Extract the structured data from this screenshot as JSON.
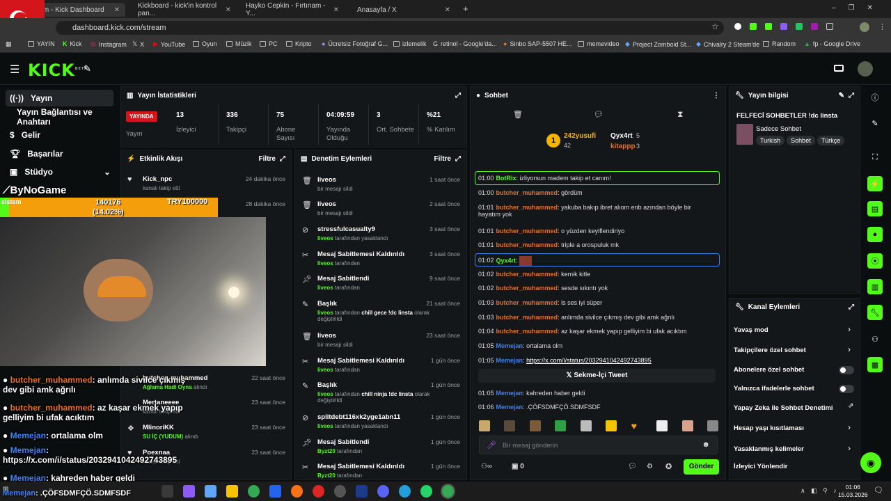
{
  "browser": {
    "tabs": [
      {
        "title": "Stream - Kick Dashboard",
        "active": true
      },
      {
        "title": "Kickboard - kick'in kontrol pan..."
      },
      {
        "title": "Hayko Cepkin - Fırtınam - Y..."
      },
      {
        "title": "Anasayfa / X"
      }
    ],
    "url": "dashboard.kick.com/stream",
    "bookmarks": [
      "YAYIN",
      "Kick",
      "Instagram",
      "X",
      "YouTube",
      "Oyun",
      "Müzik",
      "PC",
      "Kripto",
      "Ücretsiz Fotoğraf G...",
      "izlemelik",
      "retinol - Google'da...",
      "Sinbo SAP-5507 HE...",
      "memevideo",
      "Project Zomboid St...",
      "Chivalry 2 Steam'de",
      "Random",
      "fp - Google Drive"
    ]
  },
  "brand": {
    "logo": "KICK",
    "beta": "BETA",
    "accent": "#53fc18"
  },
  "sidebar": {
    "items": [
      {
        "label": "Yayın",
        "active": true
      },
      {
        "label": "Yayın Bağlantısı ve Anahtarı"
      },
      {
        "label": "Gelir"
      },
      {
        "label": "Başarılar"
      },
      {
        "label": "Stüdyo"
      }
    ]
  },
  "stats": {
    "title": "Yayın İstatistikleri",
    "status_badge": "YAYINDA",
    "status_label": "Yayın",
    "items": [
      {
        "value": "13",
        "label": "İzleyici"
      },
      {
        "value": "336",
        "label": "Takipçi"
      },
      {
        "value": "75",
        "label": "Abone Sayısı"
      },
      {
        "value": "04:09:59",
        "label": "Yayında Olduğu"
      },
      {
        "value": "3",
        "label": "Ort. Sohbete"
      },
      {
        "value": "%21",
        "label": "% Katılım"
      }
    ]
  },
  "activity": {
    "title": "Etkinlik Akışı",
    "filter": "Filtre",
    "items": [
      {
        "name": "Kick_npc",
        "desc": "kanalı takip etti",
        "time": "24 dakika önce"
      },
      {
        "name": "",
        "desc": "",
        "time": "28 dakika önce"
      },
      {
        "name": "butcher_muhammed",
        "desc": "Ağlama Hadi Oyna",
        "desc2": "alındı",
        "time": "22 saat önce"
      },
      {
        "name": "Mertaneeee",
        "desc": "kanalı takip etti",
        "time": "23 saat önce"
      },
      {
        "name": "MlinoriKK",
        "desc": "SU İÇ (YUDUM)",
        "desc2": "alındı",
        "time": "23 saat önce"
      },
      {
        "name": "Poexnaa",
        "desc": "kanalı takip etti",
        "time": "23 saat önce"
      }
    ]
  },
  "moderation": {
    "title": "Denetim Eylemleri",
    "filter": "Filtre",
    "items": [
      {
        "name": "liveos",
        "desc": "bir mesajı sildi",
        "time": "1 saat önce",
        "icon": "trash-icon"
      },
      {
        "name": "liveos",
        "desc": "bir mesajı sildi",
        "time": "2 saat önce",
        "icon": "trash-icon"
      },
      {
        "name": "stressfulcasualty9",
        "by": "liveos",
        "desc": "tarafından yasaklandı",
        "time": "3 saat önce",
        "icon": "ban-icon"
      },
      {
        "name": "Mesaj Sabitlemesi Kaldırıldı",
        "by": "liveos",
        "desc": "tarafından",
        "time": "3 saat önce",
        "icon": "unpin-icon"
      },
      {
        "name": "Mesaj Sabitlendi",
        "by": "liveos",
        "desc": "tarafından",
        "time": "9 saat önce",
        "icon": "pin-icon"
      },
      {
        "name": "Başlık",
        "by": "liveos",
        "desc": "tarafından",
        "extra": "chill gece !dc linsta",
        "desc2": "olarak değiştirildi",
        "time": "21 saat önce",
        "icon": "title-icon"
      },
      {
        "name": "liveos",
        "desc": "bir mesajı sildi",
        "time": "23 saat önce",
        "icon": "trash-icon"
      },
      {
        "name": "Mesaj Sabitlemesi Kaldırıldı",
        "by": "liveos",
        "desc": "tarafından",
        "time": "1 gün önce",
        "icon": "unpin-icon"
      },
      {
        "name": "Başlık",
        "by": "liveos",
        "desc": "tarafından",
        "extra": "chill ninja !dc linsta",
        "desc2": "olarak değiştirildi",
        "time": "1 gün önce",
        "icon": "title-icon"
      },
      {
        "name": "splitdebt116xk2yge1abn11",
        "by": "liveos",
        "desc": "tarafından yasaklandı",
        "time": "1 gün önce",
        "icon": "ban-icon"
      },
      {
        "name": "Mesaj Sabitlendi",
        "by": "Byzt20",
        "desc": "tarafından",
        "time": "1 gün önce",
        "icon": "pin-icon"
      },
      {
        "name": "Mesaj Sabitlemesi Kaldırıldı",
        "by": "Byzt20",
        "desc": "tarafından",
        "time": "1 gün önce",
        "icon": "unpin-icon"
      }
    ]
  },
  "chat": {
    "title": "Sohbet",
    "leaderboard": {
      "top": "242yusufi",
      "top_value": "42",
      "rank": "1",
      "second": "Qyx4rt",
      "second_value": "5",
      "third": "kitappp",
      "third_value": "3"
    },
    "messages": [
      {
        "time": "01:00",
        "user": "BotRix",
        "text": "izliyorsun madem takip et canım!",
        "bot": true,
        "highlight": true
      },
      {
        "time": "01:00",
        "user": "butcher_muhammed",
        "text": "gördüm"
      },
      {
        "time": "01:01",
        "user": "butcher_muhammed",
        "text": "yakuba bakıp ibret alıom enb azından böyle bir",
        "text2": "hayatım yok"
      },
      {
        "time": "01:01",
        "user": "butcher_muhammed",
        "text": "o yüzden keyiflendiriyo"
      },
      {
        "time": "01:01",
        "user": "butcher_muhammed",
        "text": "triple a orospuluk mk"
      },
      {
        "time": "01:02",
        "user": "Qyx4rt",
        "text": "",
        "highlight": true,
        "blue": true
      },
      {
        "time": "01:02",
        "user": "butcher_muhammed",
        "text": "kemik kitle"
      },
      {
        "time": "01:02",
        "user": "butcher_muhammed",
        "text": "sesde sıkıntı yok"
      },
      {
        "time": "01:03",
        "user": "butcher_muhammed",
        "text": "ls ses iyi süper"
      },
      {
        "time": "01:03",
        "user": "butcher_muhammed",
        "text": "anlımda sivilce çıkmış dev gibi amk ağrılı"
      },
      {
        "time": "01:04",
        "user": "butcher_muhammed",
        "text": "az kaşar ekmek yapıp gelliyim bi ufak acıktım"
      },
      {
        "time": "01:05",
        "user": "Memejan",
        "text": "ortalama olm",
        "blue": true
      },
      {
        "time": "01:05",
        "user": "Memejan",
        "text": "https://x.com/i/status/2032941042492743895",
        "blue": true,
        "link": true
      },
      {
        "time": "01:05",
        "user": "Memejan",
        "text": "kahreden haber geldi",
        "blue": true
      },
      {
        "time": "01:06",
        "user": "Memejan",
        "text": ".ÇÖFSDMFÇÖ.SDMFSDF",
        "blue": true
      }
    ],
    "tweet_embed": "Sekme-İçi Tweet",
    "input_placeholder": "Bir mesaj gönderin",
    "send": "Gönder",
    "chat_count": "0"
  },
  "info": {
    "title": "Yayın bilgisi",
    "stream_title": "FELFECİ SOHBETLER !dc linsta",
    "category": "Sadece Sohbet",
    "tags": [
      "Turkish",
      "Sohbet",
      "Türkçe"
    ]
  },
  "channel_actions": {
    "title": "Kanal Eylemleri",
    "items": [
      {
        "label": "Yavaş mod",
        "control": "chevron"
      },
      {
        "label": "Takipçilere özel sohbet",
        "control": "chevron"
      },
      {
        "label": "Abonelere özel sohbet",
        "control": "toggle"
      },
      {
        "label": "Yalnızca ifadelerle sohbet",
        "control": "toggle"
      },
      {
        "label": "Yapay Zeka ile Sohbet Denetimi",
        "control": "external"
      },
      {
        "label": "Hesap yaşı kısıtlaması",
        "control": "chevron"
      },
      {
        "label": "Yasaklanmış kelimeler",
        "control": "chevron"
      },
      {
        "label": "İzleyici Yönlendir",
        "control": "none"
      }
    ]
  },
  "overlay": {
    "channel": "ByNoGame",
    "goal_label": "sistem",
    "goal_current": "140176",
    "goal_percent": "(14.02%)",
    "goal_target": "TRY100000",
    "goal_progress": 0.1402,
    "lines": [
      {
        "user": "butcher_muhammed",
        "text": ": anlımda sivilce çıkmış",
        "text2": "dev gibi amk ağrılı"
      },
      {
        "user": "butcher_muhammed",
        "text": ": az kaşar ekmek yapıp",
        "text2": "gelliyim bi ufak acıktım"
      },
      {
        "user": "Memejan",
        "text": ": ortalama olm",
        "blue": true
      },
      {
        "user": "Memejan",
        "text": ":",
        "text2": "https://x.com/i/status/2032941042492743895",
        "blue": true
      },
      {
        "user": "Memejan",
        "text": ": kahreden haber geldi",
        "blue": true
      },
      {
        "user": "Memejan",
        "text": ": .ÇÖFSDMFÇÖ.SDMFSDF",
        "blue": true
      }
    ]
  },
  "taskbar": {
    "time": "01:06",
    "date": "15.03.2026"
  }
}
